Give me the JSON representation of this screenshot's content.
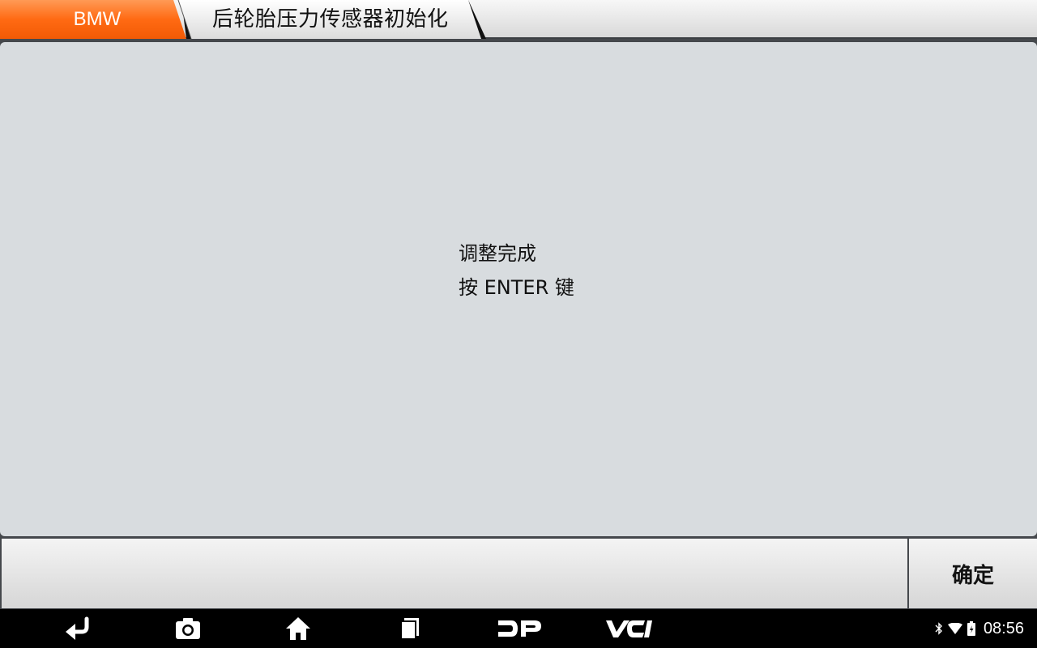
{
  "breadcrumb": {
    "brand": "BMW",
    "function": "后轮胎压力传感器初始化"
  },
  "message": {
    "line1": "调整完成",
    "line2": "按 ENTER 键"
  },
  "actions": {
    "confirm_label": "确定"
  },
  "navbar": {
    "buttons": [
      "back-icon",
      "camera-icon",
      "home-icon",
      "recent-apps-icon",
      "dp-icon",
      "vci-icon"
    ]
  },
  "status": {
    "time": "08:56",
    "icons": [
      "bluetooth-icon",
      "wifi-icon",
      "battery-icon"
    ]
  },
  "colors": {
    "accent": "#ff6a13",
    "panel": "#d8dcdf",
    "bar": "#000000"
  }
}
